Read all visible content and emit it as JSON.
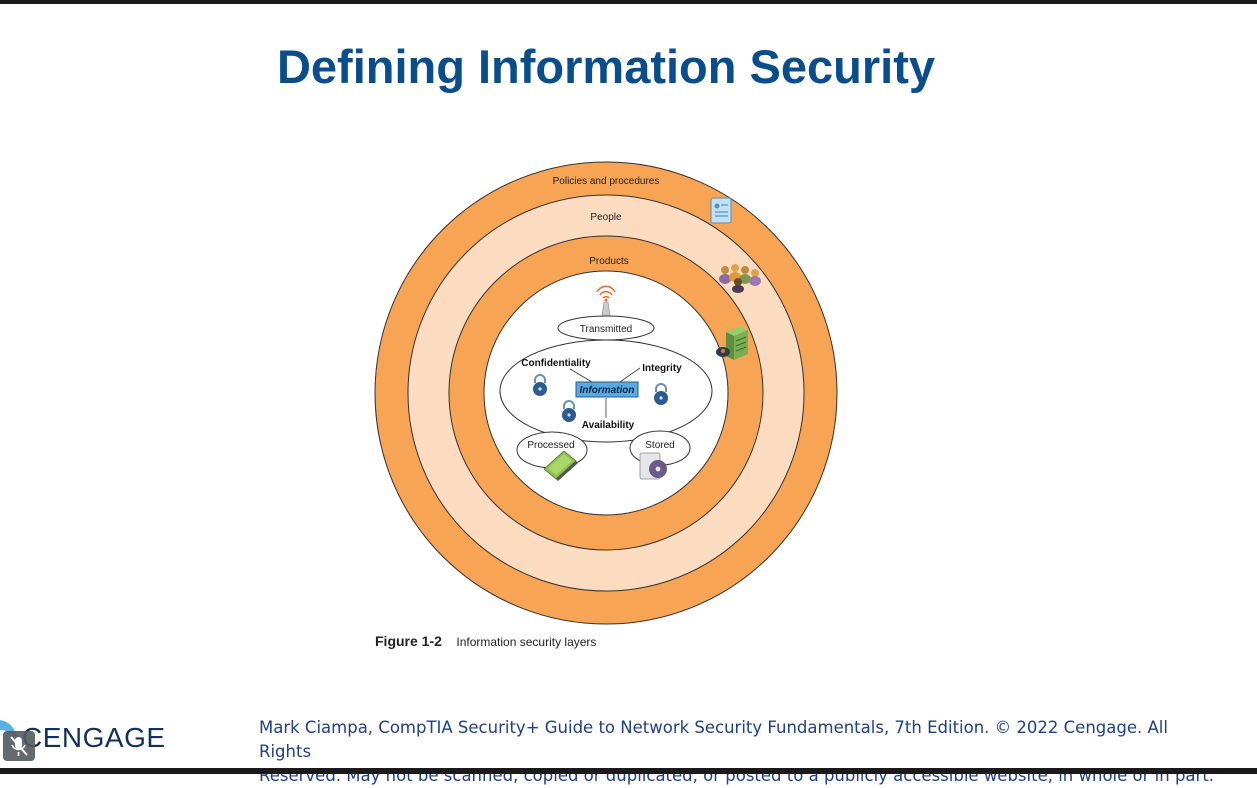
{
  "slide": {
    "title": "Defining Information Security"
  },
  "figure": {
    "layers": {
      "outer": "Policies and procedures",
      "middle": "People",
      "inner": "Products"
    },
    "core": {
      "center_label": "Information",
      "attributes": {
        "confidentiality": "Confidentiality",
        "integrity": "Integrity",
        "availability": "Availability"
      },
      "states": {
        "transmitted": "Transmitted",
        "processed": "Processed",
        "stored": "Stored"
      }
    },
    "caption": {
      "number": "Figure 1-2",
      "text": "Information security layers"
    },
    "colors": {
      "orange": "#f7a455",
      "peach": "#fcdcc0",
      "info_box": "#5aa9e0",
      "lock": "#2d5b8f"
    },
    "icons": [
      "document-icon",
      "people-group-icon",
      "server-icon",
      "antenna-icon",
      "lock-icon",
      "laptop-icon",
      "disk-drive-icon"
    ]
  },
  "footer": {
    "logo": "CENGAGE",
    "copyright_line1": "Mark Ciampa, CompTIA Security+ Guide to Network Security Fundamentals, 7th Edition. © 2022 Cengage. All Rights",
    "copyright_line2": "Reserved. May not be scanned, copied or duplicated, or posted to a publicly accessible website, in whole or in part."
  }
}
